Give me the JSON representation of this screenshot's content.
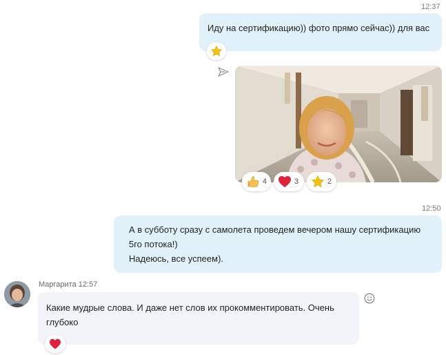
{
  "messages": {
    "m1": {
      "time": "12:37",
      "text": "Иду на сертификацию)) фото прямо сейчас)) для вас"
    },
    "photo_reactions": {
      "like_count": "4",
      "heart_count": "3",
      "star_count": "2"
    },
    "m2": {
      "time": "12:50",
      "lines": [
        "А в субботу сразу с самолета проведем вечером нашу сертификацию",
        "5го потока!)",
        "Надеюсь, все успеем)."
      ]
    },
    "m3": {
      "sender": "Маргарита",
      "time": "12:57",
      "lines": [
        "Какие мудрые слова. И даже нет слов их прокомментировать. Очень",
        "глубоко"
      ]
    }
  },
  "icons": {
    "star": "star-icon",
    "like": "thumbs-up-icon",
    "heart": "heart-icon",
    "pending": "send-pending-icon",
    "emoji": "smiley-icon"
  },
  "colors": {
    "outgoing_bubble": "#e1f1fa",
    "incoming_bubble": "#f2f4f7",
    "heart": "#e0223a",
    "star": "#f4c20d"
  }
}
